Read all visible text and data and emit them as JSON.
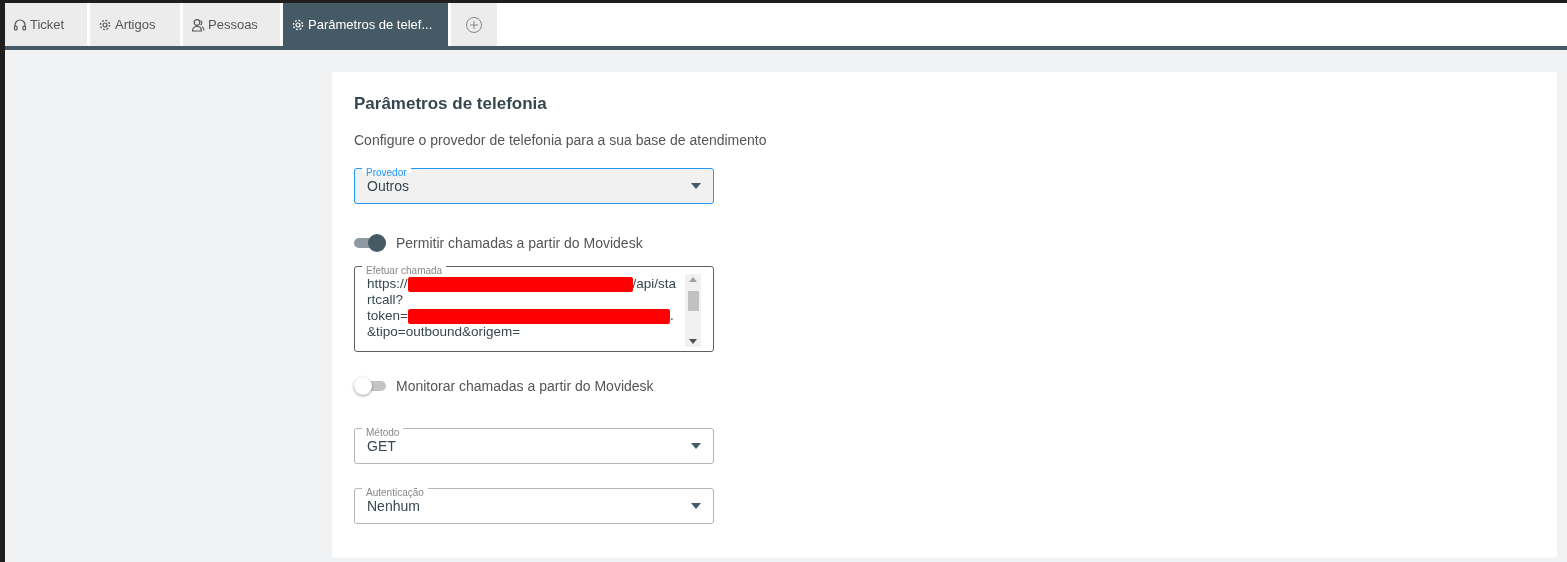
{
  "tabs": [
    {
      "label": "Ticket",
      "selected": false
    },
    {
      "label": "Artigos",
      "selected": false
    },
    {
      "label": "Pessoas",
      "selected": false
    },
    {
      "label": "Parâmetros de telef...",
      "selected": true
    }
  ],
  "panel": {
    "title": "Parâmetros de telefonia",
    "description": "Configure o provedor de telefonia para a sua base de atendimento",
    "fields": [
      {
        "kind": "select",
        "label": "Provedor",
        "value": "Outros",
        "focused": true
      },
      {
        "kind": "toggle",
        "label": "Permitir chamadas a partir do Movidesk",
        "on": true
      },
      {
        "kind": "textarea",
        "label": "Efetuar chamada",
        "lines": [
          [
            {
              "kind": "text",
              "text": "https://"
            },
            {
              "kind": "redacted"
            },
            {
              "kind": "text",
              "text": "/api/sta"
            }
          ],
          [
            {
              "kind": "text",
              "text": "rtcall?"
            }
          ],
          [
            {
              "kind": "text",
              "text": "token="
            },
            {
              "kind": "redacted"
            },
            {
              "kind": "text",
              "text": "."
            }
          ],
          [
            {
              "kind": "text",
              "text": "&tipo=outbound&origem="
            }
          ]
        ]
      },
      {
        "kind": "toggle",
        "label": "Monitorar chamadas a partir do Movidesk",
        "on": false
      },
      {
        "kind": "select",
        "label": "Método",
        "value": "GET",
        "focused": false
      },
      {
        "kind": "select",
        "label": "Autenticação",
        "value": "Nenhum",
        "focused": false
      }
    ]
  }
}
